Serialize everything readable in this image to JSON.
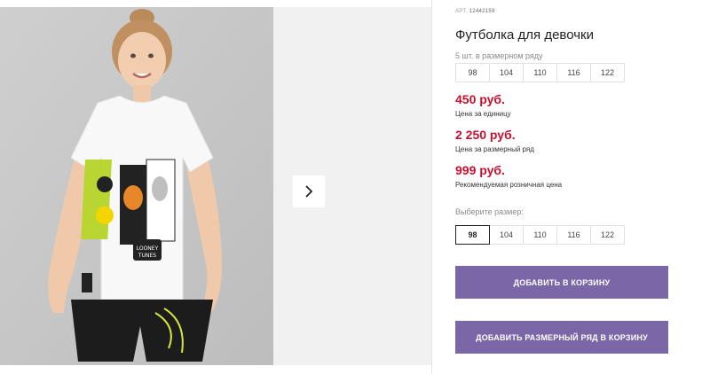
{
  "product": {
    "article_prefix": "АРТ.",
    "article_number": "12442159",
    "title": "Футболка для девочки"
  },
  "size_range": {
    "caption": "5 шт. в размерном ряду",
    "sizes": [
      "98",
      "104",
      "110",
      "116",
      "122"
    ]
  },
  "prices": [
    {
      "value": "450 руб.",
      "label": "Цена за единицу"
    },
    {
      "value": "2 250 руб.",
      "label": "Цена за размерный ряд"
    },
    {
      "value": "999 руб.",
      "label": "Рекомендуемая розничная цена"
    }
  ],
  "size_select": {
    "caption": "Выберите размер:",
    "sizes": [
      "98",
      "104",
      "110",
      "116",
      "122"
    ],
    "selected": "98"
  },
  "buttons": {
    "add_to_cart": "ДОБАВИТЬ В КОРЗИНУ",
    "add_range_to_cart": "ДОБАВИТЬ РАЗМЕРНЫЙ РЯД В КОРЗИНУ"
  },
  "colors": {
    "price": "#c8102e",
    "button": "#7b66a8"
  }
}
